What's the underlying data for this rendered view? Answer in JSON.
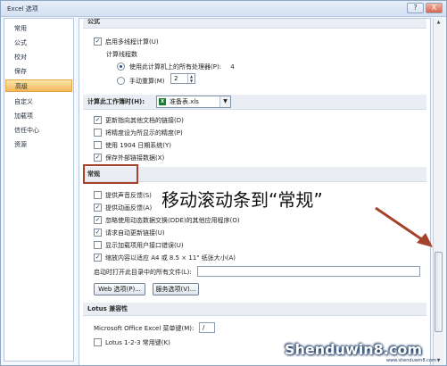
{
  "window": {
    "title": "Excel 选项",
    "help_label": "?",
    "close_label": "X"
  },
  "sidebar": {
    "items": [
      {
        "label": "常用"
      },
      {
        "label": "公式"
      },
      {
        "label": "校对"
      },
      {
        "label": "保存"
      },
      {
        "label": "高级",
        "active": true
      },
      {
        "label": "自定义"
      },
      {
        "label": "加载项"
      },
      {
        "label": "信任中心"
      },
      {
        "label": "资源"
      }
    ]
  },
  "formulas": {
    "header": "公式",
    "multithread_label": "启用多线程计算(U)",
    "thread_count_label": "计算线程数",
    "use_all_processors_label": "使用此计算机上的所有处理器(P):",
    "processor_count": "4",
    "manual_label": "手动重算(M)",
    "manual_value": "2"
  },
  "workbook_calc": {
    "header": "计算此工作簿时(H):",
    "selected_workbook": "准备表.xls",
    "file_icon": "excel-file-icon",
    "options": [
      {
        "label": "更新指向其他文档的链接(D)",
        "checked": true
      },
      {
        "label": "将精度设为所显示的精度(P)",
        "checked": false
      },
      {
        "label": "使用 1904 日期系统(Y)",
        "checked": false
      },
      {
        "label": "保存外部链接数据(X)",
        "checked": true
      }
    ]
  },
  "general": {
    "header": "常规",
    "options": [
      {
        "label": "提供声音反馈(S)",
        "checked": false
      },
      {
        "label": "提供动画反馈(A)",
        "checked": true
      },
      {
        "label": "忽略使用动态数据交换(DDE)的其他应用程序(O)",
        "checked": true
      },
      {
        "label": "请求自动更新链接(U)",
        "checked": true
      },
      {
        "label": "显示加载项用户接口错误(U)",
        "checked": false
      },
      {
        "label": "缩放内容以适应 A4 或 8.5 × 11\" 纸张大小(A)",
        "checked": true
      }
    ],
    "startup_label": "启动时打开此目录中的所有文件(L):",
    "startup_value": "",
    "web_options_button": "Web 选项(P)...",
    "service_options_button": "服务选项(V)..."
  },
  "lotus": {
    "header": "Lotus 兼容性",
    "menu_key_label": "Microsoft Office Excel 菜单键(M):",
    "menu_key_value": "/",
    "nav_keys_label": "Lotus 1-2-3 常用键(K)"
  },
  "annotation": "移动滚动条到“常规”",
  "watermark": {
    "text": "Shenduwin8.com",
    "sub": "www.shenduwin8.com"
  },
  "colors": {
    "highlight": "#a5432a",
    "selected_nav": "#f5b75a",
    "arrow": "#a5432a"
  }
}
